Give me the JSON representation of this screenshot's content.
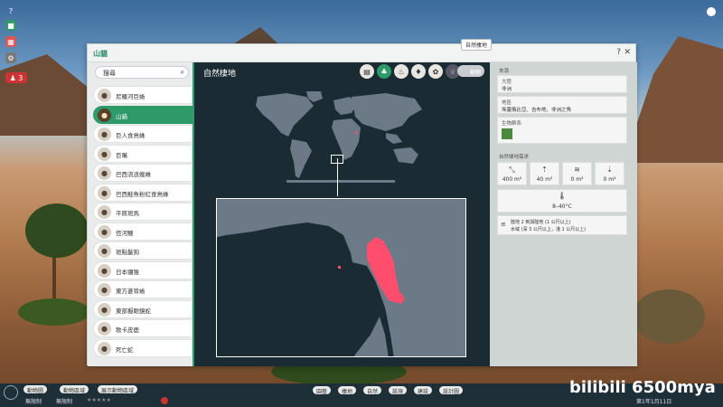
{
  "window": {
    "title": "山貓",
    "tooltip": "自然棲地",
    "help_label": "?",
    "close_label": "✕"
  },
  "search": {
    "value": "搜尋",
    "icon": "search-icon"
  },
  "animals": [
    {
      "label": "尼羅河巨蜥",
      "selected": false
    },
    {
      "label": "山貓",
      "selected": true
    },
    {
      "label": "巨人食鳥蛛",
      "selected": false
    },
    {
      "label": "巨嘴",
      "selected": false
    },
    {
      "label": "巴西流浪蜘蛛",
      "selected": false
    },
    {
      "label": "巴西鮭魚粉紅食鳥蛛",
      "selected": false
    },
    {
      "label": "平原斑馬",
      "selected": false
    },
    {
      "label": "恆河鱷",
      "selected": false
    },
    {
      "label": "斑點鬣狗",
      "selected": false
    },
    {
      "label": "日本獼猴",
      "selected": false
    },
    {
      "label": "東方菱背蜥",
      "selected": false
    },
    {
      "label": "東部擬眼鏡蛇",
      "selected": false
    },
    {
      "label": "歌卡皮鹿",
      "selected": false
    },
    {
      "label": "死亡蛇",
      "selected": false
    }
  ],
  "map": {
    "title": "自然棲地",
    "tabs": [
      {
        "name": "info-tab",
        "glyph": "▤",
        "active": false
      },
      {
        "name": "habitat-tab",
        "glyph": "♣",
        "active": true
      },
      {
        "name": "food-tab",
        "glyph": "♨",
        "active": false
      },
      {
        "name": "genetics-tab",
        "glyph": "♦",
        "active": false
      },
      {
        "name": "paw-tab",
        "glyph": "✿",
        "active": false
      },
      {
        "name": "trophy-tab",
        "glyph": "♛",
        "active": false
      }
    ],
    "corner_button": "動物"
  },
  "info": {
    "origin_title": "來源",
    "continent_label": "大陸",
    "continent_value": "非洲",
    "region_label": "地區",
    "region_value": "埃塞俄比亞、吉布地、非洲之角",
    "biome_label": "生物群系",
    "requirements_title": "自然棲地需求",
    "requirements": [
      {
        "icon": "land-area-icon",
        "glyph": "⤡",
        "value": "400 m²"
      },
      {
        "icon": "climbable-area-icon",
        "glyph": "⇡",
        "value": "40 m²"
      },
      {
        "icon": "water-area-icon",
        "glyph": "≋",
        "value": "0 m²"
      },
      {
        "icon": "deep-water-icon",
        "glyph": "⇣",
        "value": "0 m²"
      }
    ],
    "temperature": "8–40°C",
    "water_text_1": "陸地 2 到與陸地 (1 公尺以上)",
    "water_text_2": "水域 (深 3 公尺以上，淺 1 公尺以上)"
  },
  "bottom": {
    "btn1": "動物圖",
    "btn2": "動物區域",
    "btn3": "展示動物區域",
    "limit1": "無限制",
    "limit2": "無限制",
    "center_buttons": [
      "園藝",
      "棲地",
      "自然",
      "設施",
      "建設",
      "設計圖"
    ],
    "date": "第1年1月11日"
  },
  "watermark": "bilibili 6500mya",
  "colors": {
    "accent": "#2e9a6a",
    "habitat": "#ff4d6d",
    "land": "#6b7a86",
    "ocean": "#1b2b33"
  }
}
